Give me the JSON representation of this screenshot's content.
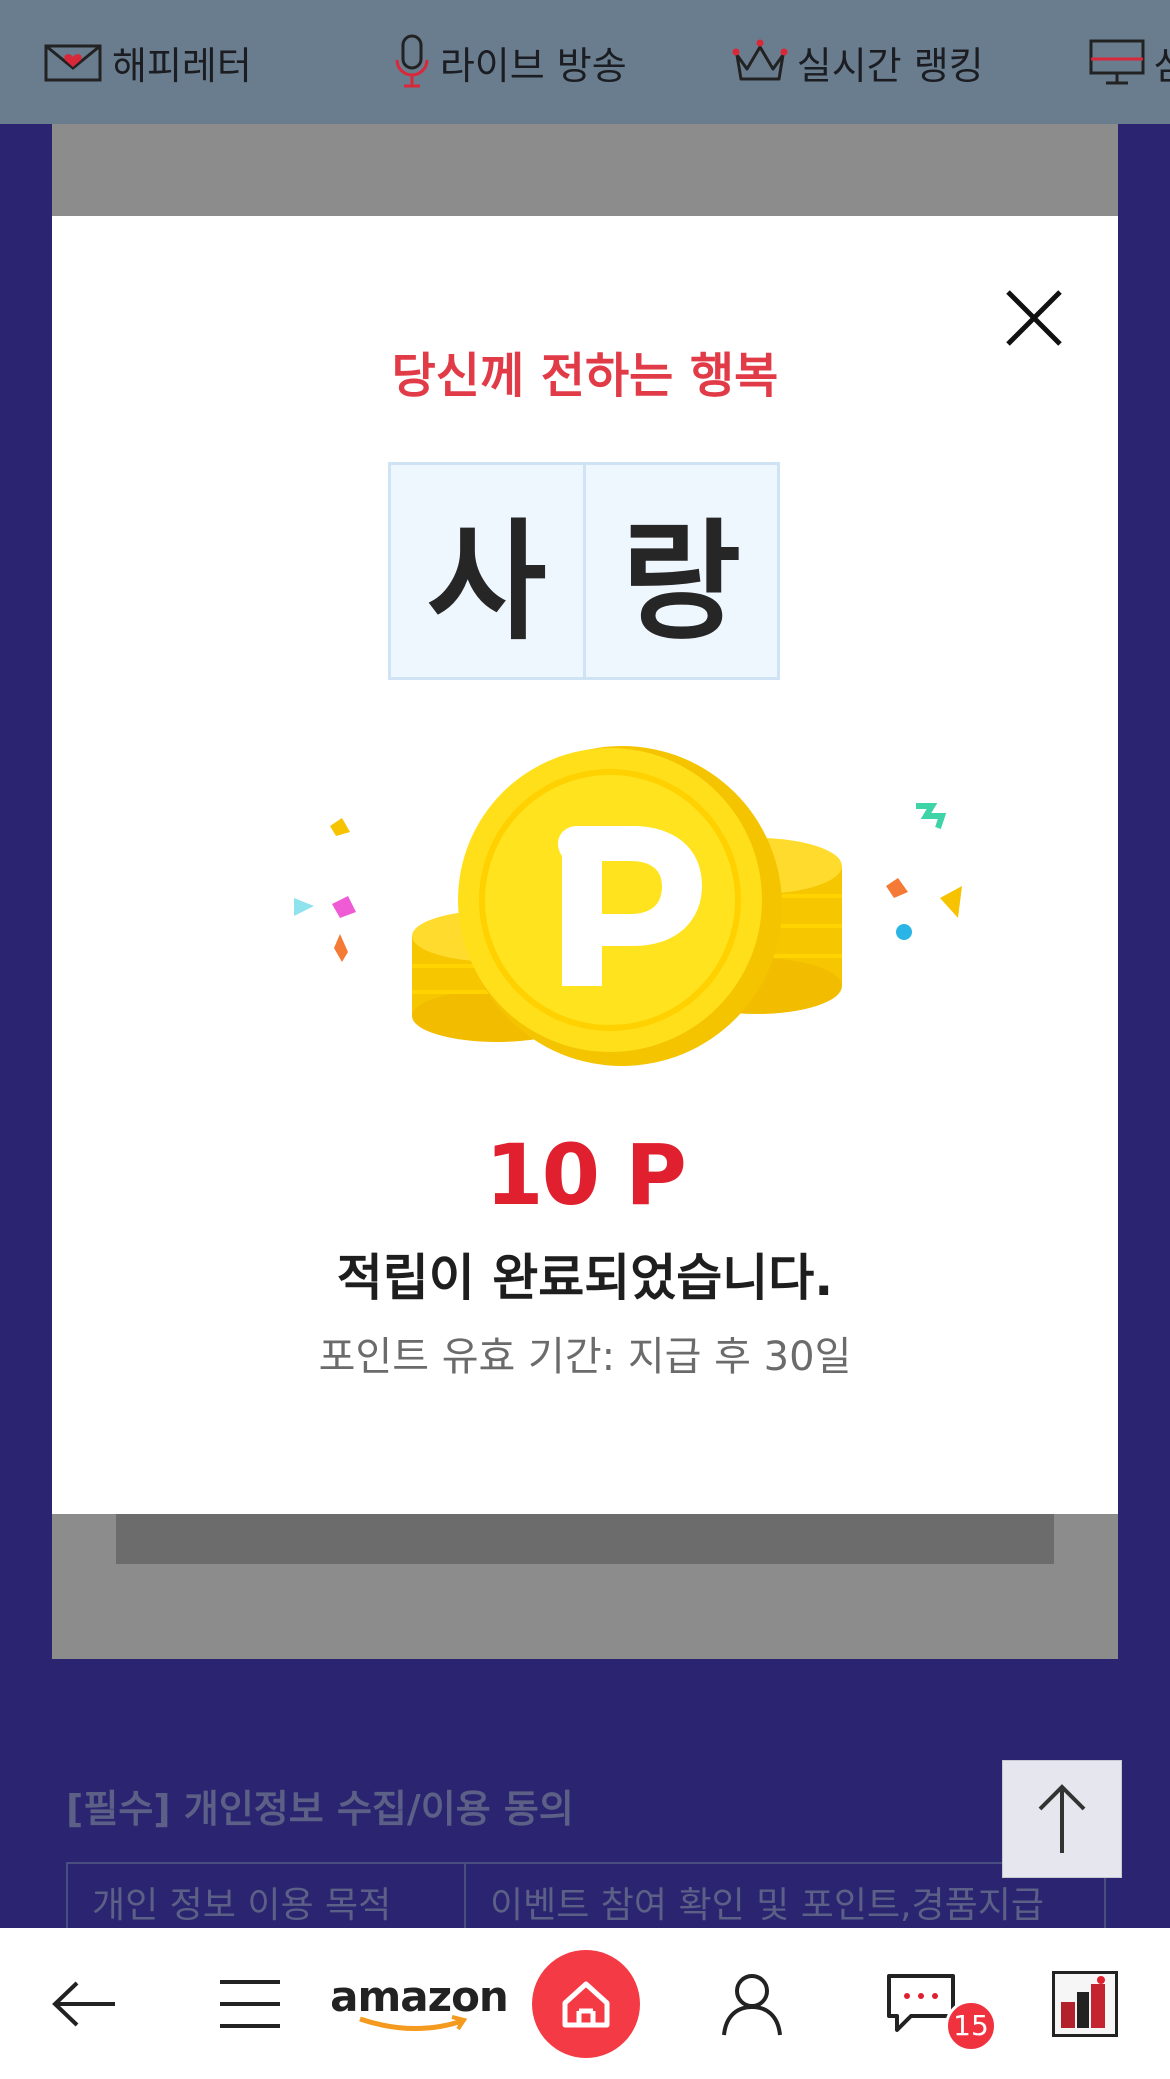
{
  "top_nav": {
    "items": [
      {
        "label": "해피레터",
        "icon": "envelope-icon"
      },
      {
        "label": "라이브 방송",
        "icon": "microphone-icon"
      },
      {
        "label": "실시간 랭킹",
        "icon": "crown-icon"
      },
      {
        "label": "삼성",
        "icon": "monitor-icon"
      }
    ]
  },
  "modal": {
    "subtitle": "당신께 전하는 행복",
    "word_chars": [
      "사",
      "랑"
    ],
    "points": "10 P",
    "message": "적립이 완료되었습니다.",
    "validity": "포인트 유효 기간: 지급 후 30일",
    "icon": "point-coins-icon"
  },
  "consent": {
    "title": "[필수] 개인정보 수집/이용 동의",
    "row": [
      "개인 정보 이용 목적",
      "이벤트 참여 확인 및 포인트,경품지급"
    ]
  },
  "bottom_bar": {
    "brand": "amazon",
    "chat_badge": "15"
  },
  "colors": {
    "accent_red": "#e23b48",
    "nav_bg": "#6a7d8e",
    "page_bg": "#2b2470"
  }
}
